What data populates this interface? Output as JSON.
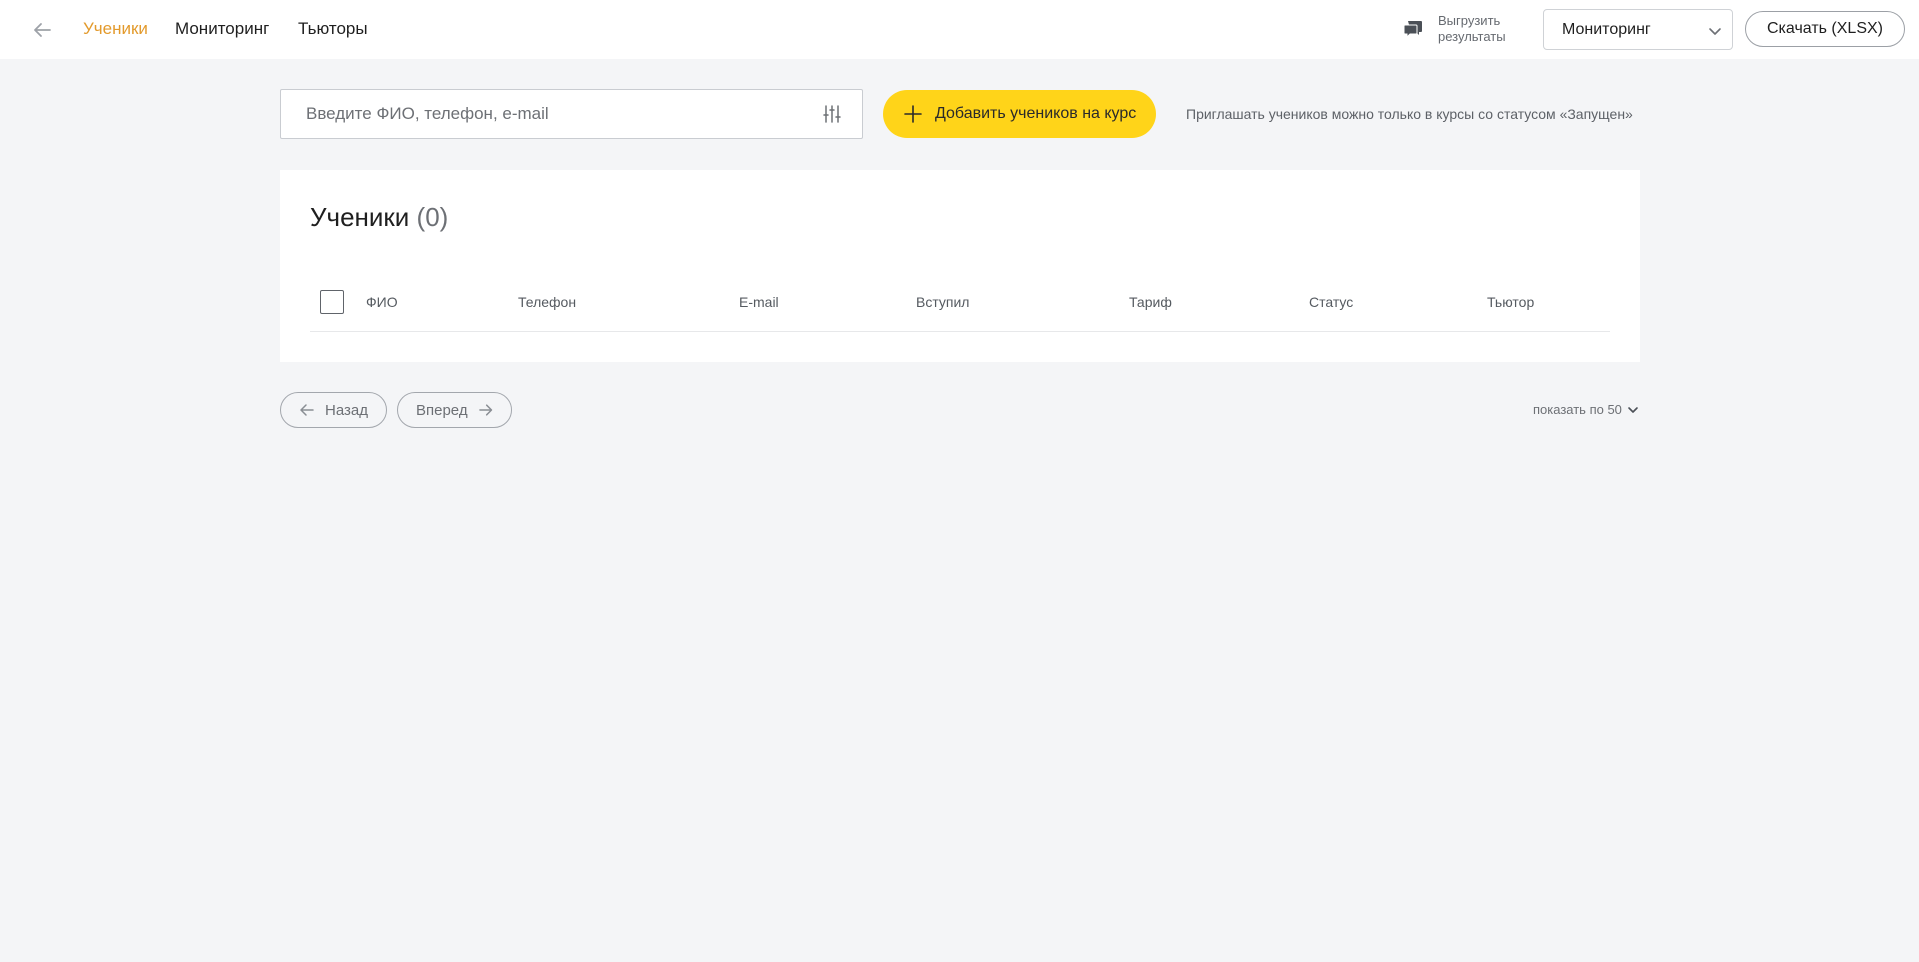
{
  "nav": {
    "tabs": [
      {
        "label": "Ученики",
        "active": true
      },
      {
        "label": "Мониторинг",
        "active": false
      },
      {
        "label": "Тьюторы",
        "active": false
      }
    ],
    "export_label_line1": "Выгрузить",
    "export_label_line2": "результаты",
    "select_value": "Мониторинг",
    "download_label": "Скачать (XLSX)"
  },
  "toolbar": {
    "search_placeholder": "Введите ФИО, телефон, e-mail",
    "add_button_label": "Добавить учеников на курс",
    "hint": "Приглашать учеников можно только в курсы со статусом «Запущен»"
  },
  "card": {
    "title": "Ученики",
    "count": "(0)",
    "columns": [
      "ФИО",
      "Телефон",
      "E-mail",
      "Вступил",
      "Тариф",
      "Статус",
      "Тьютор"
    ]
  },
  "pagination": {
    "prev_label": "Назад",
    "next_label": "Вперед",
    "per_page_label": "показать по 50"
  },
  "colors": {
    "accent": "#e39a2c",
    "add_button": "#ffd419",
    "background": "#f4f5f7"
  },
  "icons": [
    "back-arrow-icon",
    "chat-export-icon",
    "chevron-down-icon",
    "filter-sliders-icon",
    "plus-icon",
    "arrow-left-icon",
    "arrow-right-icon"
  ]
}
